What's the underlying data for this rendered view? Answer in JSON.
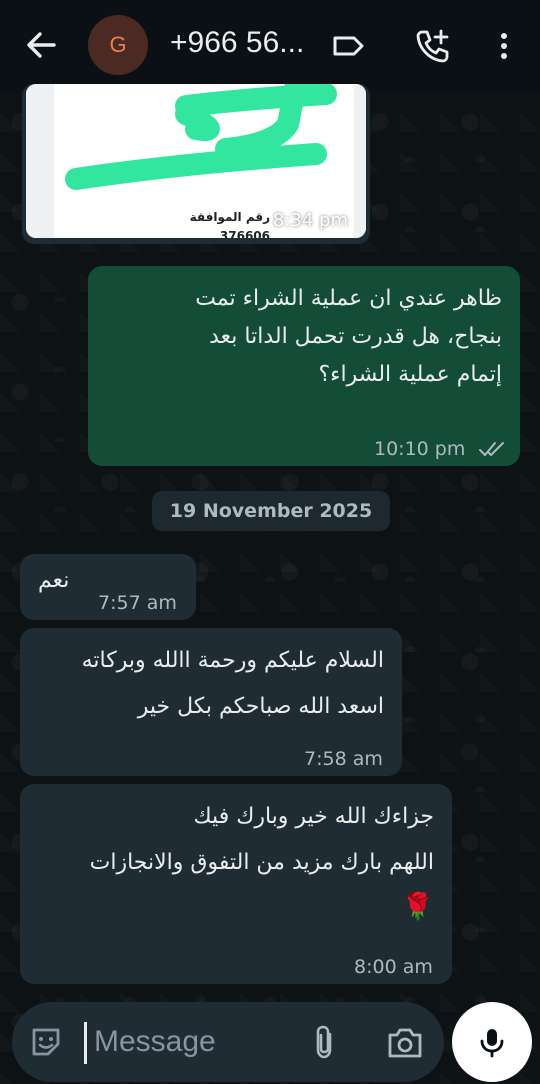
{
  "header": {
    "avatar_letter": "G",
    "contact_name": "+966 56...",
    "icons": [
      "back-arrow-icon",
      "label-icon",
      "add-call-icon",
      "more-vert-icon"
    ]
  },
  "messages": [
    {
      "type": "image",
      "direction": "incoming",
      "image_text_line1": "رقم الموافقة",
      "image_text_line2": "376606",
      "time": "8:34 pm"
    },
    {
      "type": "text",
      "direction": "outgoing",
      "lines": [
        "ظاهر عندي ان عملية الشراء تمت",
        "بنجاح، هل قدرت تحمل الداتا بعد",
        "إتمام عملية الشراء؟"
      ],
      "time": "10:10 pm",
      "status": "read"
    },
    {
      "type": "date",
      "label": "19 November 2025"
    },
    {
      "type": "text",
      "direction": "incoming",
      "lines": [
        "نعم"
      ],
      "time": "7:57 am"
    },
    {
      "type": "text",
      "direction": "incoming",
      "lines": [
        "السلام عليكم ورحمة االله وبركاته",
        "اسعد الله صباحكم بكل خير"
      ],
      "time": "7:58 am"
    },
    {
      "type": "text",
      "direction": "incoming",
      "lines": [
        "جزاءك الله خير وبارك فيك",
        "اللهم بارك مزيد من التفوق والانجازات",
        "🌹"
      ],
      "time": "8:00 am"
    }
  ],
  "input": {
    "placeholder": "Message"
  },
  "colors": {
    "outgoing_bubble": "#134d37",
    "incoming_bubble": "#1f2c33",
    "background": "#0b1014",
    "read_tick": "#aebac1"
  }
}
